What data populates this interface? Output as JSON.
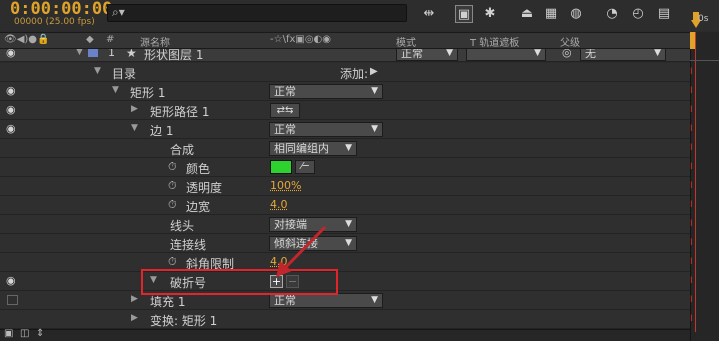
{
  "header": {
    "timecode": "0:00:00:00",
    "fps": "00000 (25.00 fps)",
    "search_placeholder": "",
    "search_icon": "search-icon"
  },
  "columns": {
    "num": "#",
    "source_name": "源名称",
    "switches": "-☆\\fx▣◎◐◉",
    "mode": "模式",
    "trkmat": "T  轨道遮板",
    "parent": "父级"
  },
  "layer": {
    "index": "1",
    "name": "形状图层 1",
    "mode": "正常",
    "parent": "无",
    "label_color": "#6a83c8"
  },
  "rows": {
    "contents": "目录",
    "add": "添加:",
    "rect_group": "矩形 1",
    "rect_group_mode": "正常",
    "rect_path": "矩形路径 1",
    "stroke": "边 1",
    "stroke_mode": "正常",
    "composite": "合成",
    "composite_value": "相同编组内",
    "color": "颜色",
    "color_swatch": "#2ed22e",
    "opacity": "透明度",
    "opacity_value": "100%",
    "width": "边宽",
    "width_value": "4.0",
    "line_cap": "线头",
    "line_cap_value": "对接端",
    "line_join": "连接线",
    "line_join_value": "倾斜连接",
    "miter_limit": "斜角限制",
    "miter_limit_value": "4.0",
    "dashes": "破折号",
    "fill": "填充 1",
    "fill_mode": "正常",
    "transform": "变换: 矩形 1"
  },
  "timeline": {
    "cti_label": "0s"
  },
  "colors": {
    "accent": "#e0a32a",
    "highlight_box": "#e2252b",
    "keyframe": "#c0392b"
  }
}
